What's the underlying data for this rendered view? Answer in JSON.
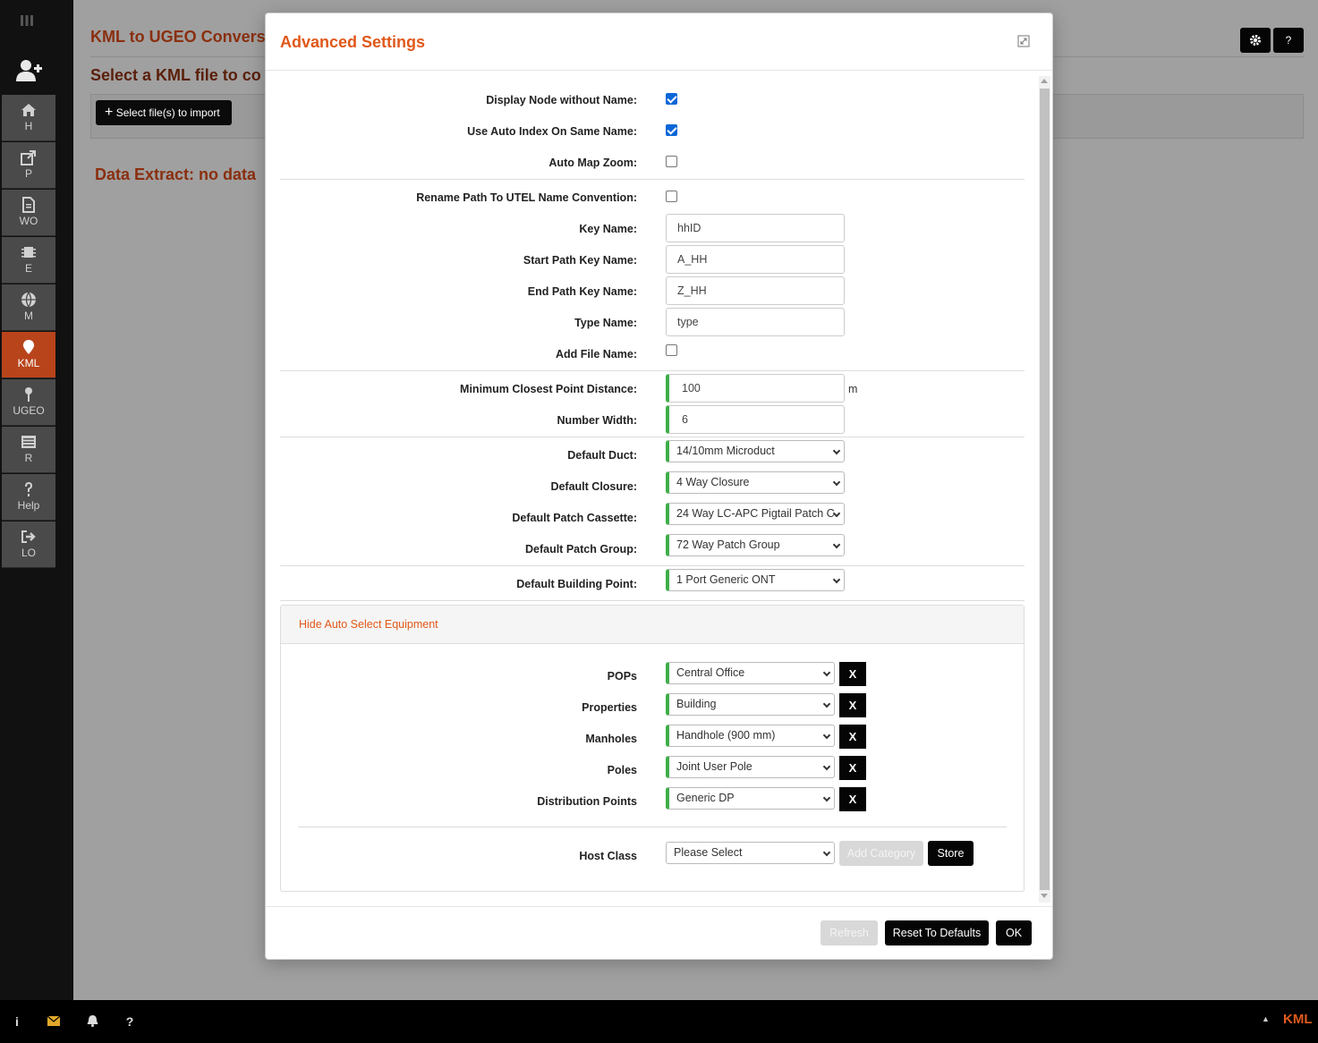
{
  "sidebar": {
    "items": [
      {
        "label": "H",
        "icon": "home-icon",
        "active": false
      },
      {
        "label": "P",
        "icon": "export-icon",
        "active": false
      },
      {
        "label": "WO",
        "icon": "document-icon",
        "active": false
      },
      {
        "label": "E",
        "icon": "chip-icon",
        "active": false
      },
      {
        "label": "M",
        "icon": "globe-icon",
        "active": false
      },
      {
        "label": "KML",
        "icon": "map-pin-icon",
        "active": true
      },
      {
        "label": "UGEO",
        "icon": "pushpin-icon",
        "active": false
      },
      {
        "label": "R",
        "icon": "list-icon",
        "active": false
      },
      {
        "label": "Help",
        "icon": "question-icon",
        "active": false
      },
      {
        "label": "LO",
        "icon": "logout-icon",
        "active": false
      }
    ]
  },
  "page": {
    "title": "KML to UGEO Convers",
    "subtitle": "Select a KML file to co",
    "select_button": "Select file(s) to import",
    "extract_status": "Data Extract: no data",
    "help_button": "?"
  },
  "modal": {
    "title": "Advanced Settings",
    "display_node_without_name": {
      "label": "Display Node without Name:",
      "checked": true
    },
    "use_auto_index": {
      "label": "Use Auto Index On Same Name:",
      "checked": true
    },
    "auto_map_zoom": {
      "label": "Auto Map Zoom:",
      "checked": false
    },
    "rename_path": {
      "label": "Rename Path To UTEL Name Convention:",
      "checked": false
    },
    "key_name": {
      "label": "Key Name:",
      "value": "hhID"
    },
    "start_path_key": {
      "label": "Start Path Key Name:",
      "value": "A_HH"
    },
    "end_path_key": {
      "label": "End Path Key Name:",
      "value": "Z_HH"
    },
    "type_name": {
      "label": "Type Name:",
      "value": "type"
    },
    "add_file_name": {
      "label": "Add File Name:",
      "checked": false
    },
    "min_closest_distance": {
      "label": "Minimum Closest Point Distance:",
      "value": "100",
      "unit": "m"
    },
    "number_width": {
      "label": "Number Width:",
      "value": "6"
    },
    "default_duct": {
      "label": "Default Duct:",
      "value": "14/10mm Microduct"
    },
    "default_closure": {
      "label": "Default Closure:",
      "value": "4 Way Closure"
    },
    "default_patch_cassette": {
      "label": "Default Patch Cassette:",
      "value": "24 Way LC-APC Pigtail Patch C"
    },
    "default_patch_group": {
      "label": "Default Patch Group:",
      "value": "72 Way Patch Group"
    },
    "default_building_point": {
      "label": "Default Building Point:",
      "value": "1 Port Generic ONT"
    },
    "equipment": {
      "toggle_link": "Hide Auto Select Equipment",
      "rows": [
        {
          "label": "POPs",
          "value": "Central Office"
        },
        {
          "label": "Properties",
          "value": "Building"
        },
        {
          "label": "Manholes",
          "value": "Handhole (900 mm)"
        },
        {
          "label": "Poles",
          "value": "Joint User Pole"
        },
        {
          "label": "Distribution Points",
          "value": "Generic DP"
        }
      ],
      "remove_label": "X",
      "host_class": {
        "label": "Host Class",
        "value": "Please Select"
      },
      "add_category": "Add Category",
      "store": "Store"
    },
    "footer": {
      "refresh": "Refresh",
      "reset": "Reset To Defaults",
      "ok": "OK"
    }
  },
  "bottombar": {
    "info": "i",
    "help": "?",
    "tag": "KML"
  },
  "colors": {
    "accent": "#e0581a",
    "active_nav": "#b8441b",
    "valid_border": "#3fae49",
    "checkbox": "#0a66d8"
  }
}
